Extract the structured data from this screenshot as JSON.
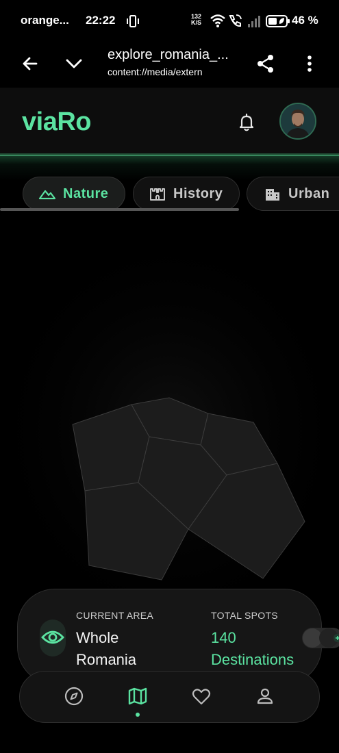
{
  "status_bar": {
    "carrier": "orange...",
    "time": "22:22",
    "net_speed_top": "132",
    "net_speed_bottom": "K/S",
    "battery": "46 %",
    "icons": [
      "vibrate-icon",
      "wifi-icon",
      "wifi-calling-icon",
      "signal-icon",
      "battery-saver-icon"
    ]
  },
  "browser_bar": {
    "title": "explore_romania_...",
    "url": "content://media/extern",
    "icons": [
      "back-arrow-icon",
      "chevron-down-icon",
      "share-icon",
      "more-vert-icon"
    ]
  },
  "app": {
    "logo": "viaRo",
    "accent_color": "#5be3a1",
    "icons": [
      "bell-icon",
      "avatar"
    ]
  },
  "categories": [
    {
      "label": "Nature",
      "icon": "mountain-icon",
      "active": true
    },
    {
      "label": "History",
      "icon": "castle-icon",
      "active": false
    },
    {
      "label": "Urban",
      "icon": "building-icon",
      "active": false
    }
  ],
  "info_card": {
    "area_label": "CURRENT AREA",
    "area_value": "Whole Romania",
    "spots_label": "TOTAL SPOTS",
    "spots_value": "140 Destinations",
    "icon": "eye-icon"
  },
  "bottom_nav": [
    {
      "name": "explore",
      "icon": "compass-icon",
      "active": false
    },
    {
      "name": "map",
      "icon": "map-icon",
      "active": true
    },
    {
      "name": "favorites",
      "icon": "heart-icon",
      "active": false
    },
    {
      "name": "profile",
      "icon": "person-icon",
      "active": false
    }
  ]
}
